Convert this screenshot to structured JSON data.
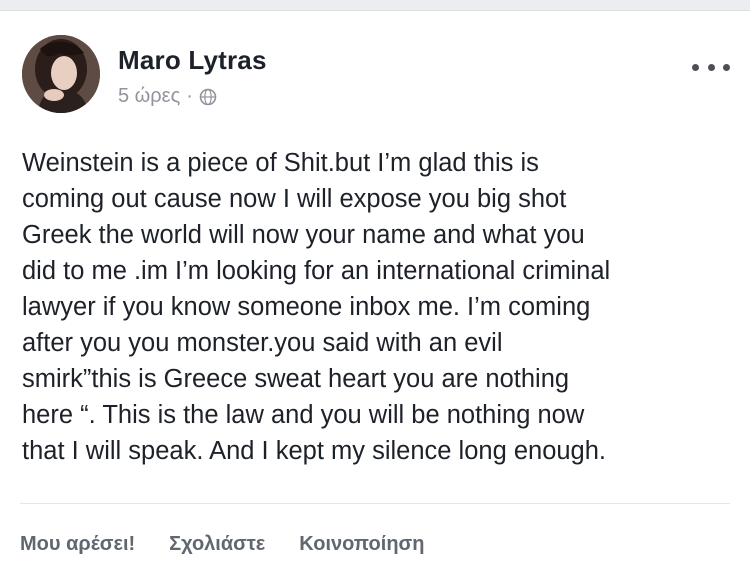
{
  "post": {
    "author_name": "Maro Lytras",
    "timestamp": "5 ώρες",
    "separator": "·",
    "privacy_icon": "globe-icon",
    "more_icon": "more-options-icon",
    "body": "Weinstein is a piece of Shit.but I’m glad this is\ncoming out cause now I will expose you big shot\nGreek the world will now your name and what you\ndid to me .im I’m looking for an international criminal\nlawyer if you know someone inbox me. I’m coming\nafter you you monster.you said with an evil\nsmirk”this is Greece sweat heart you are nothing\nhere “. This is the law and you will be nothing now\nthat I will speak. And I kept my silence long enough."
  },
  "actions": {
    "like_label": "Μου αρέσει!",
    "comment_label": "Σχολιάστε",
    "share_label": "Κοινοποίηση"
  },
  "colors": {
    "author": "#1d2129",
    "meta": "#90949c",
    "action": "#616770",
    "background": "#ffffff"
  }
}
